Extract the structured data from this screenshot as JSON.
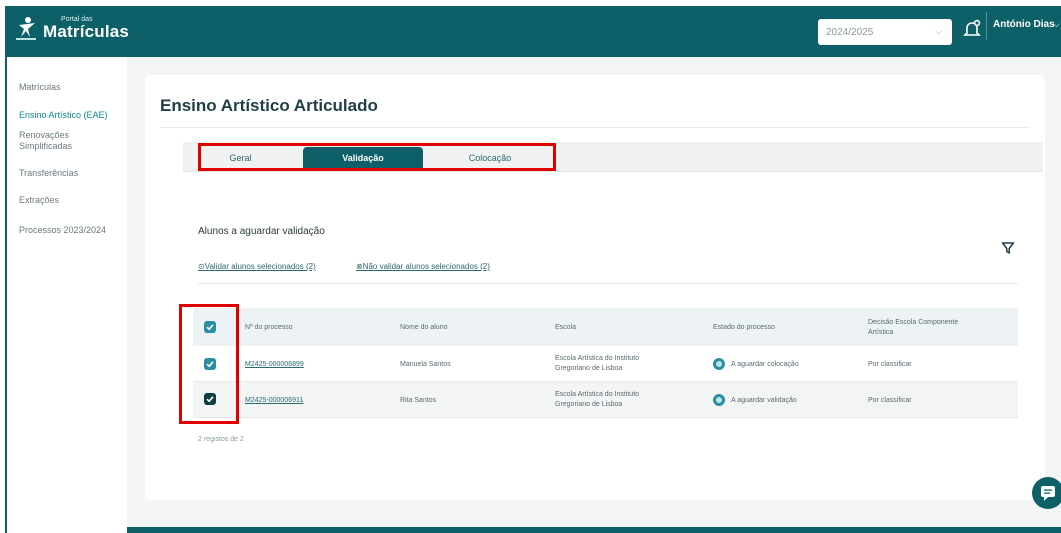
{
  "header": {
    "logo_small": "Portal das",
    "logo_big": "Matrículas",
    "year_value": "2024/2025",
    "user_name": "António Dias"
  },
  "sidebar": {
    "items": [
      {
        "label": "Matrículas"
      },
      {
        "label": "Ensino Artístico (EAE)"
      },
      {
        "label_line1": "Renovações",
        "label_line2": "Simplificadas"
      },
      {
        "label": "Transferências"
      },
      {
        "label": "Extrações"
      },
      {
        "label": "Processos 2023/2024"
      }
    ]
  },
  "main": {
    "title": "Ensino Artístico Articulado",
    "tabs": [
      {
        "label": "Geral"
      },
      {
        "label": "Validação"
      },
      {
        "label": "Colocação"
      }
    ],
    "section_title": "Alunos a aguardar validação",
    "actions": {
      "validate": "Validar alunos selecionados (2)",
      "not_validate": "Não validar alunos selecionados (2)"
    },
    "table": {
      "headers": {
        "process": "Nº do processo",
        "name": "Nome do aluno",
        "school": "Escola",
        "state": "Estado do processo",
        "decision_1": "Decisão Escola Componente",
        "decision_2": "Artística"
      },
      "rows": [
        {
          "process": "M2425-000006899",
          "name": "Manuela Santos",
          "school_1": "Escola Artística do Instituto",
          "school_2": "Gregoriano de Lisboa",
          "state": "A aguardar colocação",
          "decision": "Por classificar"
        },
        {
          "process": "M2425-000006911",
          "name": "Rita Santos",
          "school_1": "Escola Artística do Instituto",
          "school_2": "Gregoriano de Lisboa",
          "state": "A aguardar validação",
          "decision": "Por classificar"
        }
      ],
      "footer": "2 registos de 2"
    }
  },
  "colors": {
    "primary": "#0e6068",
    "accent": "#2a8fa0",
    "highlight_box": "#e00000"
  }
}
